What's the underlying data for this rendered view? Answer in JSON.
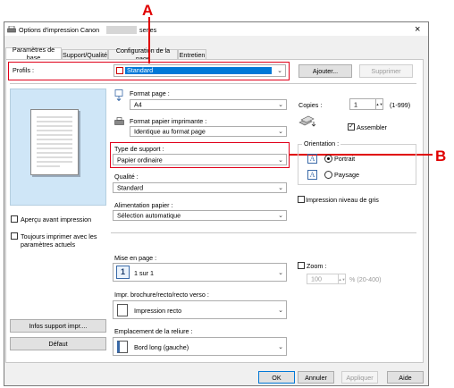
{
  "callouts": {
    "a": "A",
    "b": "B"
  },
  "window": {
    "title_prefix": "Options d'impression Canon",
    "title_suffix": "series",
    "close_label": "×"
  },
  "tabs": [
    {
      "label": "Paramètres de base"
    },
    {
      "label": "Support/Qualité"
    },
    {
      "label": "Configuration de la page"
    },
    {
      "label": "Entretien"
    }
  ],
  "profiles": {
    "label": "Profils :",
    "value": "Standard",
    "add_label": "Ajouter...",
    "delete_label": "Supprimer"
  },
  "preview": {
    "show_label": "Aperçu avant impression",
    "always_print_label": "Toujours imprimer avec les paramètres actuels"
  },
  "page_size": {
    "label": "Format page :",
    "value": "A4"
  },
  "printer_paper": {
    "label": "Format papier imprimante :",
    "value": "Identique au format page"
  },
  "media_type": {
    "label": "Type de support :",
    "value": "Papier ordinaire"
  },
  "quality": {
    "label": "Qualité :",
    "value": "Standard"
  },
  "paper_source": {
    "label": "Alimentation papier :",
    "value": "Sélection automatique"
  },
  "copies": {
    "label": "Copies :",
    "value": "1",
    "range": "(1-999)",
    "collate_label": "Assembler",
    "collate_checked": true
  },
  "orientation": {
    "label": "Orientation :",
    "portrait": "Portrait",
    "landscape": "Paysage",
    "selected": "portrait"
  },
  "grayscale": {
    "label": "Impression niveau de gris"
  },
  "layout": {
    "label": "Mise en page :",
    "value": "1 sur 1",
    "icon": "1"
  },
  "duplex": {
    "label": "Impr. brochure/recto/recto verso :",
    "value": "Impression recto"
  },
  "binding": {
    "label": "Emplacement de la reliure :",
    "value": "Bord long (gauche)"
  },
  "zoom": {
    "label": "Zoom :",
    "value": "100",
    "range": "% (20-400)"
  },
  "side_buttons": {
    "support_info": "Infos support impr....",
    "default": "Défaut"
  },
  "footer": {
    "ok": "OK",
    "cancel": "Annuler",
    "apply": "Appliquer",
    "help": "Aide"
  },
  "colors": {
    "callout_red": "#e00000",
    "combo_highlight": "#0078d7"
  }
}
